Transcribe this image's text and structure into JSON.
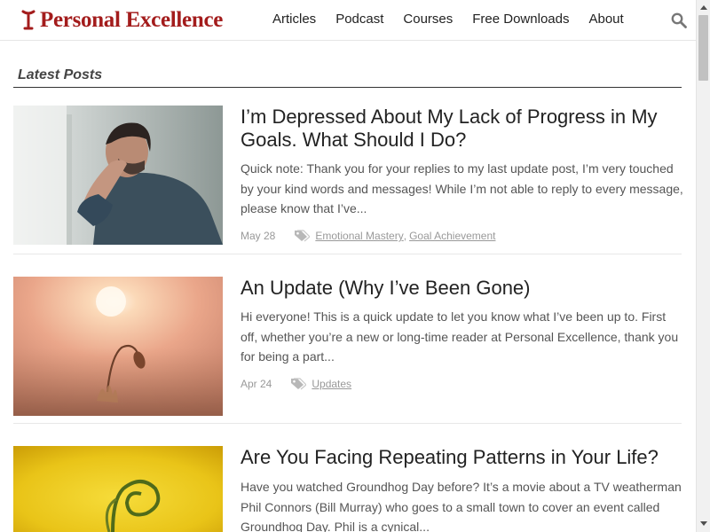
{
  "site": {
    "name": "Personal Excellence",
    "brand_color": "#a31c1c"
  },
  "nav": {
    "items": [
      {
        "label": "Articles"
      },
      {
        "label": "Podcast"
      },
      {
        "label": "Courses"
      },
      {
        "label": "Free Downloads"
      },
      {
        "label": "About"
      }
    ],
    "search_icon": "search-icon"
  },
  "section": {
    "title": "Latest Posts"
  },
  "posts": [
    {
      "title": "I’m Depressed About My Lack of Progress in My Goals. What Should I Do?",
      "excerpt": "Quick note: Thank you for your replies to my last update post, I’m very touched by your kind words and messages! While I’m not able to reply to every message, please know that I’ve...",
      "date": "May 28",
      "categories": [
        "Emotional Mastery",
        "Goal Achievement"
      ],
      "separator": ","
    },
    {
      "title": "An Update (Why I’ve Been Gone)",
      "excerpt": "Hi everyone! This is a quick update to let you know what I’ve been up to. First off, whether you’re a new or long-time reader at Personal Excellence, thank you for being a part...",
      "date": "Apr 24",
      "categories": [
        "Updates"
      ]
    },
    {
      "title": "Are You Facing Repeating Patterns in Your Life?",
      "excerpt": "Have you watched Groundhog Day before? It’s a movie about a TV weatherman Phil Connors (Bill Murray) who goes to a small town to cover an event called Groundhog Day. Phil is a cynical..."
    }
  ]
}
